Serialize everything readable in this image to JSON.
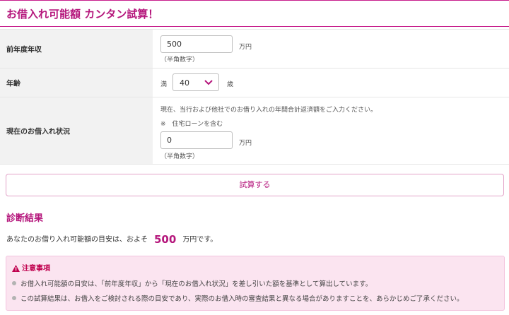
{
  "title": "お借入れ可能額 カンタン試算！",
  "form": {
    "income": {
      "label": "前年度年収",
      "value": "500",
      "unit": "万円",
      "note": "（半角数字）"
    },
    "age": {
      "label": "年齢",
      "prefix": "満",
      "value": "40",
      "suffix": "歳"
    },
    "debt": {
      "label": "現在のお借入れ状況",
      "description": "現在、当行および他社でのお借り入れの年間合計返済額をご入力ください。",
      "housing_note": "※　住宅ローンを含む",
      "value": "0",
      "unit": "万円",
      "note": "（半角数字）"
    }
  },
  "calc_button": "試算する",
  "result": {
    "heading": "診断結果",
    "prefix": "あなたのお借り入れ可能額の目安は、およそ",
    "amount": "500",
    "suffix": "万円です。"
  },
  "notice": {
    "heading": "注意事項",
    "items": [
      "お借入れ可能額の目安は、「前年度年収」から「現在のお借入れ状況」を差し引いた額を基準として算出しています。",
      "この試算結果は、お借入をご検討される際の目安であり、実際のお借入時の審査結果と異なる場合がありますことを、あらかじめご了承ください。"
    ]
  },
  "colors": {
    "accent": "#b5177c",
    "notice_bg": "#fbe4f0",
    "warning": "#c0004e"
  }
}
